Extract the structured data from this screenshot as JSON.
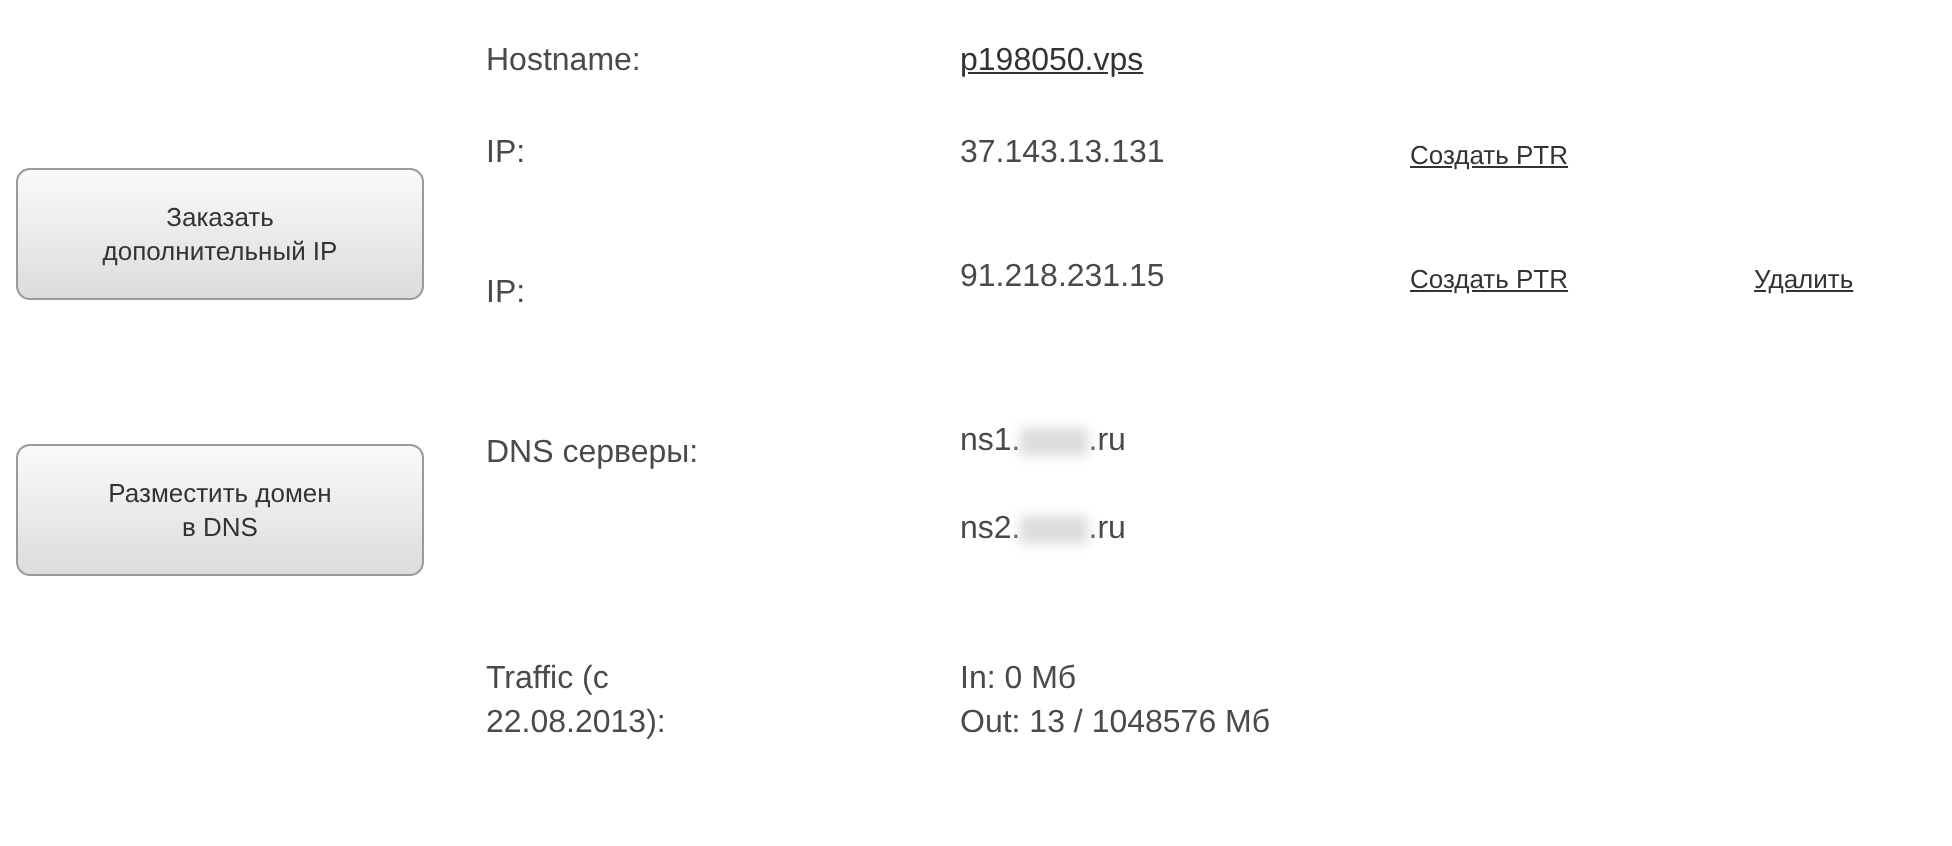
{
  "hostname": {
    "label": "Hostname:",
    "value": "p198050.vps"
  },
  "buttons": [
    {
      "lines": [
        "Заказать",
        "дополнительный IP"
      ]
    },
    {
      "lines": [
        "Разместить домен",
        "в DNS"
      ]
    }
  ],
  "ip_addresses": [
    {
      "label": "IP:",
      "value": "37.143.13.131",
      "links": [
        "Создать PTR"
      ]
    },
    {
      "label": "IP:",
      "value": "91.218.231.15",
      "links": [
        "Создать PTR",
        "Удалить"
      ]
    }
  ],
  "dns": {
    "label": "DNS серверы:",
    "servers": [
      {
        "prefix": "ns1.",
        "suffix": ".ru",
        "redacted": true
      },
      {
        "prefix": "ns2.",
        "suffix": ".ru",
        "redacted": true
      }
    ]
  },
  "traffic": {
    "label_lines": [
      "Traffic (с",
      "22.08.2013):"
    ],
    "value_lines": [
      "In: 0 Мб",
      "Out: 13 / 1048576 Мб"
    ]
  }
}
